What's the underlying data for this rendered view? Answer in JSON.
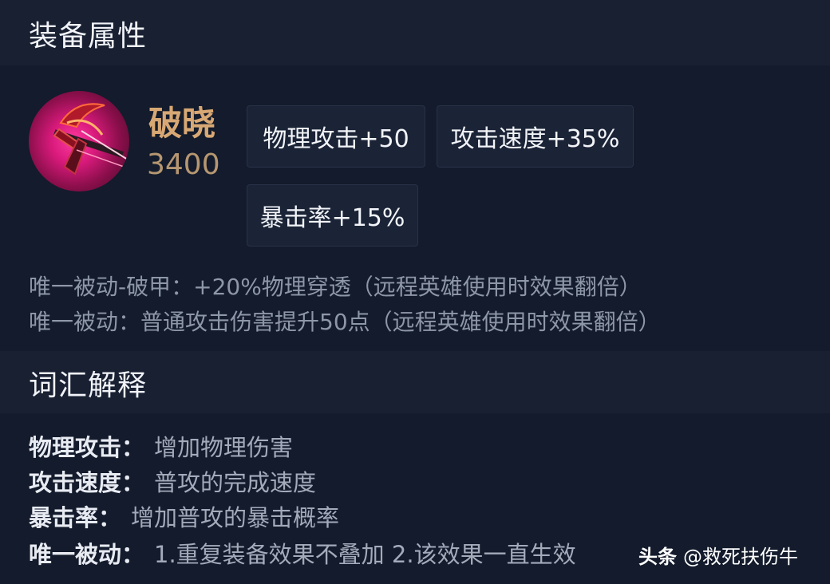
{
  "section_equipment": {
    "title": "装备属性"
  },
  "item": {
    "name": "破晓",
    "price": "3400",
    "icon": "crossbow-icon",
    "stats": [
      "物理攻击+50",
      "攻击速度+35%",
      "暴击率+15%"
    ],
    "passives": [
      "唯一被动-破甲：+20%物理穿透（远程英雄使用时效果翻倍）",
      "唯一被动：普通攻击伤害提升50点（远程英雄使用时效果翻倍）"
    ]
  },
  "section_glossary": {
    "title": "词汇解释",
    "entries": [
      {
        "term": "物理攻击：",
        "definition": "增加物理伤害"
      },
      {
        "term": "攻击速度：",
        "definition": "普攻的完成速度"
      },
      {
        "term": "暴击率：",
        "definition": "增加普攻的暴击概率"
      },
      {
        "term": "唯一被动：",
        "definition": "1.重复装备效果不叠加 2.该效果一直生效"
      }
    ]
  },
  "watermark": {
    "brand": "头条",
    "handle": "@救死扶伤牛"
  },
  "colors": {
    "background": "#131b2c",
    "header_bg": "#182032",
    "item_name": "#d8a874",
    "price": "#b69771"
  }
}
